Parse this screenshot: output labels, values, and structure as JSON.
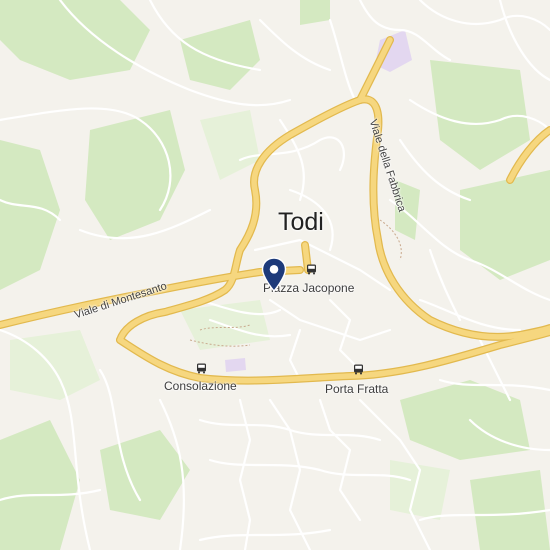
{
  "map": {
    "city": "Todi",
    "places": {
      "piazza": "Piazza Jacopone",
      "consolazione": "Consolazione",
      "porta_fratta": "Porta Fratta"
    },
    "streets": {
      "montesanto": "Viale di Montesanto",
      "fabbrica": "Viale della Fabbrica"
    },
    "colors": {
      "background": "#f4f2ec",
      "green": "#cfe7b9",
      "road_minor": "#ffffff",
      "road_major": "#f6d77f",
      "marker": "#1d3a7a",
      "purple_area": "#e3d7f0"
    },
    "icons": {
      "marker": "location-pin-icon",
      "bus": "bus-stop-icon"
    }
  }
}
